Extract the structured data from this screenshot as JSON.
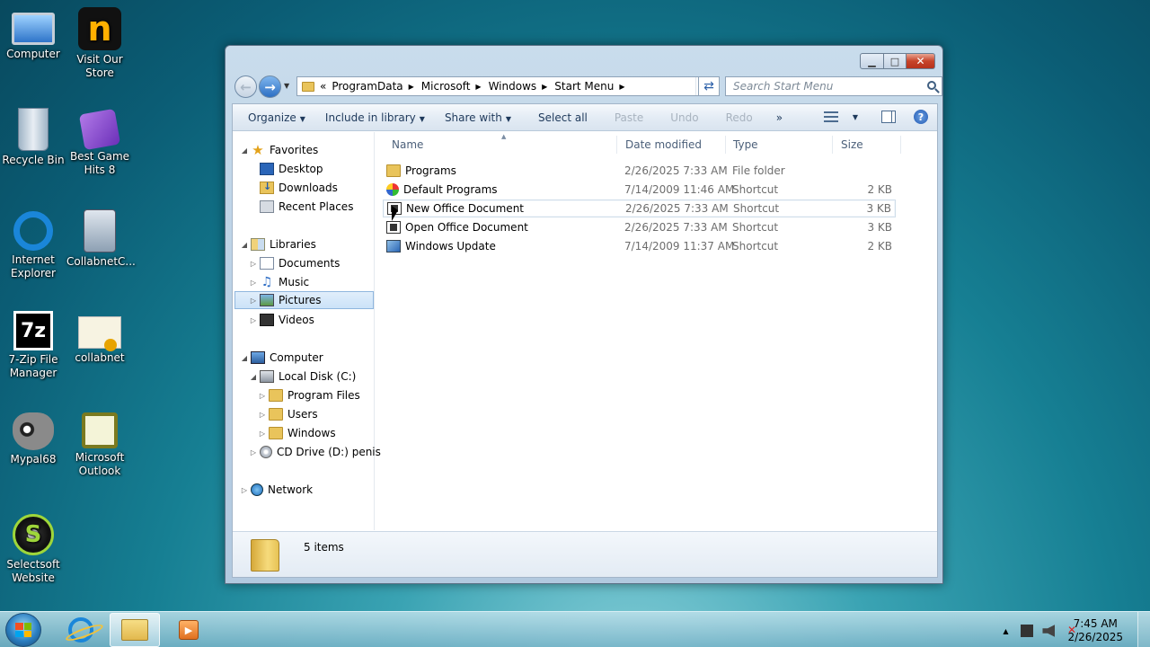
{
  "desktop": {
    "icons": [
      {
        "label": "Computer"
      },
      {
        "label": "Visit Our Store",
        "glyph": "n"
      },
      {
        "label": "Recycle Bin"
      },
      {
        "label": "Best Game Hits 8"
      },
      {
        "label": "Internet Explorer"
      },
      {
        "label": "CollabnetC..."
      },
      {
        "label": "7-Zip File Manager",
        "glyph": "7z"
      },
      {
        "label": "collabnet"
      },
      {
        "label": "Mypal68"
      },
      {
        "label": "Microsoft Outlook"
      },
      {
        "label": "Selectsoft Website",
        "glyph": "S"
      }
    ]
  },
  "window": {
    "caption": {
      "minimize": "▁",
      "maximize": "□",
      "close": "✕"
    },
    "address": {
      "overflow": "«",
      "crumbs": [
        "ProgramData",
        "Microsoft",
        "Windows",
        "Start Menu"
      ],
      "separator": "▶"
    },
    "search": {
      "placeholder": "Search Start Menu"
    },
    "toolbar": {
      "organize": "Organize",
      "include": "Include in library",
      "share": "Share with",
      "select_all": "Select all",
      "paste": "Paste",
      "undo": "Undo",
      "redo": "Redo",
      "more": "»"
    },
    "nav": {
      "favorites": "Favorites",
      "desktop": "Desktop",
      "downloads": "Downloads",
      "recent": "Recent Places",
      "libraries": "Libraries",
      "documents": "Documents",
      "music": "Music",
      "pictures": "Pictures",
      "videos": "Videos",
      "computer": "Computer",
      "local_disk": "Local Disk (C:)",
      "program_files": "Program Files",
      "users": "Users",
      "windows": "Windows",
      "cd_drive": "CD Drive (D:) penis",
      "network": "Network"
    },
    "columns": {
      "name": "Name",
      "date": "Date modified",
      "type": "Type",
      "size": "Size"
    },
    "files": [
      {
        "name": "Programs",
        "date": "2/26/2025 7:33 AM",
        "type": "File folder",
        "size": "",
        "icon": "folder-icon"
      },
      {
        "name": "Default Programs",
        "date": "7/14/2009 11:46 AM",
        "type": "Shortcut",
        "size": "2 KB",
        "icon": "default-programs-icon"
      },
      {
        "name": "New Office Document",
        "date": "2/26/2025 7:33 AM",
        "type": "Shortcut",
        "size": "3 KB",
        "icon": "office-document-icon"
      },
      {
        "name": "Open Office Document",
        "date": "2/26/2025 7:33 AM",
        "type": "Shortcut",
        "size": "3 KB",
        "icon": "office-document-icon"
      },
      {
        "name": "Windows Update",
        "date": "7/14/2009 11:37 AM",
        "type": "Shortcut",
        "size": "2 KB",
        "icon": "windows-update-icon"
      }
    ],
    "status": {
      "count": "5 items"
    }
  },
  "taskbar": {
    "clock_time": "7:45 AM",
    "clock_date": "2/26/2025"
  },
  "colors": {
    "desktop": "#167f93",
    "close_button": "#c7442a",
    "selection": "#cbe2f8"
  }
}
